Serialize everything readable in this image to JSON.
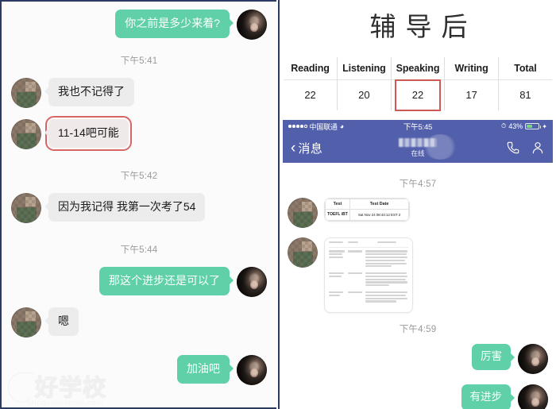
{
  "left_conversation": {
    "messages": [
      {
        "kind": "message",
        "side": "right",
        "text": "你之前是多少来着?",
        "avatar": "selfie",
        "highlight": false
      },
      {
        "kind": "time",
        "text": "下午5:41"
      },
      {
        "kind": "message",
        "side": "left",
        "text": "我也不记得了",
        "avatar": "pixelated",
        "highlight": false
      },
      {
        "kind": "message",
        "side": "left",
        "text": "11-14吧可能",
        "avatar": "pixelated",
        "highlight": true
      },
      {
        "kind": "time",
        "text": "下午5:42"
      },
      {
        "kind": "message",
        "side": "left",
        "text": "因为我记得 我第一次考了54",
        "avatar": "pixelated",
        "highlight": false
      },
      {
        "kind": "time",
        "text": "下午5:44"
      },
      {
        "kind": "message",
        "side": "right",
        "text": "那这个进步还是可以了",
        "avatar": "selfie",
        "highlight": false
      },
      {
        "kind": "message",
        "side": "left",
        "text": "嗯",
        "avatar": "pixelated",
        "highlight": false
      },
      {
        "kind": "message",
        "side": "right",
        "text": "加油吧",
        "avatar": "selfie",
        "highlight": false
      }
    ],
    "watermark": {
      "logo_text": "好学校",
      "url_text": "httpgoodschool.com"
    },
    "accent_bubble_self": "#5fd0a8",
    "accent_bubble_other": "#ececec",
    "highlight_color": "#d86666"
  },
  "right_panel": {
    "title": "辅导后",
    "score_table": {
      "headers": [
        "Reading",
        "Listening",
        "Speaking",
        "Writing",
        "Total"
      ],
      "values": [
        "22",
        "20",
        "22",
        "17",
        "81"
      ],
      "highlighted_column": "Speaking",
      "highlight_color": "#cf5a55"
    },
    "status_bar": {
      "carrier": "中国联通",
      "wifi_icon": "wifi-icon",
      "time": "下午5:45",
      "alarm_icon": "alarm-clock-icon",
      "battery_label": "43%",
      "battery_percent": 43,
      "battery_color": "#79d97a"
    },
    "nav_bar": {
      "back_icon": "chevron-left-icon",
      "back_label": "消息",
      "contact_name": "",
      "presence": "在线",
      "call_icon": "phone-icon",
      "profile_icon": "person-icon",
      "background": "#5260ab"
    },
    "conversation": {
      "messages": [
        {
          "kind": "time",
          "text": "下午4:57"
        },
        {
          "kind": "card_table",
          "side": "left",
          "avatar": "pixelated",
          "headers": [
            "Test",
            "Test Date"
          ],
          "row": [
            "TOEFL iBT",
            "Sat Nov 24 08:44:12 EST 2"
          ]
        },
        {
          "kind": "card_document",
          "side": "left",
          "avatar": "pixelated"
        },
        {
          "kind": "time",
          "text": "下午4:59"
        },
        {
          "kind": "message",
          "side": "right",
          "text": "厉害",
          "avatar": "selfie"
        },
        {
          "kind": "message",
          "side": "right",
          "text": "有进步",
          "avatar": "selfie"
        }
      ]
    }
  }
}
